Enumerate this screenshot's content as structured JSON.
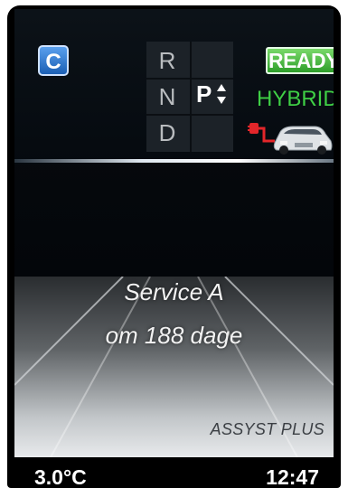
{
  "status": {
    "c_badge": "C",
    "ready": "READY",
    "hybrid": "HYBRID"
  },
  "gear": {
    "positions": [
      "R",
      "N",
      "D"
    ],
    "current": "P"
  },
  "message": {
    "line1": "Service A",
    "line2": "om 188 dage",
    "system": "ASSYST PLUS"
  },
  "footer": {
    "temperature": "3.0°C",
    "time": "12:47"
  },
  "colors": {
    "ready_bg": "#3aa934",
    "hybrid_text": "#3fcf45",
    "c_badge_bg": "#2a6fc4"
  },
  "icons": [
    "car-charging-icon",
    "gear-selector-arrows-icon"
  ]
}
